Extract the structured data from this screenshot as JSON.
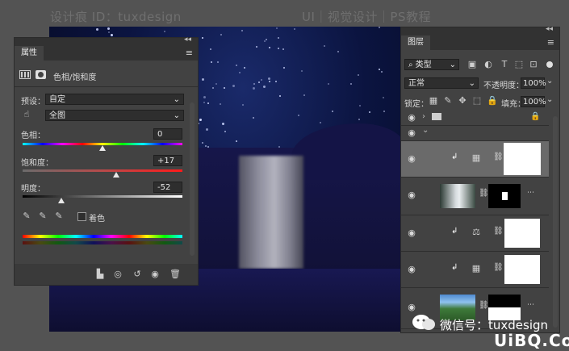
{
  "header": {
    "left": "设计痕 ID：tuxdesign",
    "right": "UI｜视觉设计｜PS教程"
  },
  "properties": {
    "tab": "属性",
    "adjustment_title": "色相/饱和度",
    "preset_label": "预设：",
    "preset_value": "自定",
    "channel_value": "全图",
    "hue_label": "色相：",
    "hue_value": "0",
    "saturation_label": "饱和度：",
    "saturation_value": "+17",
    "lightness_label": "明度：",
    "lightness_value": "-52",
    "colorize_label": "着色",
    "colorize_checked": false,
    "sliders": {
      "hue": 0,
      "saturation": 17,
      "lightness": -52
    }
  },
  "layers": {
    "tab": "图层",
    "filter_kind": "类型",
    "blend_mode": "正常",
    "opacity_label": "不透明度：",
    "opacity_value": "100%",
    "lock_label": "锁定：",
    "fill_label": "填充：",
    "fill_value": "100%"
  },
  "watermark": {
    "wechat": "微信号：tuxdesign",
    "site": "UiBQ.CoM"
  },
  "colors": {
    "panel_bg": "#424242",
    "app_bg": "#535353",
    "canvas_sky": "#0b1440",
    "accent_white": "#ffffff"
  }
}
